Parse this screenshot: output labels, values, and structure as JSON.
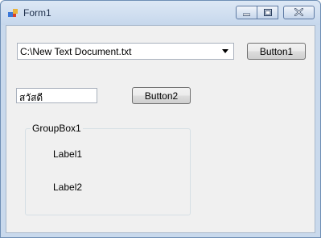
{
  "window": {
    "title": "Form1",
    "icon": "windows-form-icon",
    "caption_buttons": [
      "minimize-icon",
      "maximize-icon",
      "close-icon"
    ]
  },
  "combo": {
    "value": "C:\\New Text Document.txt",
    "arrow_icon": "chevron-down-icon"
  },
  "button1": {
    "label": "Button1"
  },
  "textbox": {
    "value": "สวัสดี"
  },
  "button2": {
    "label": "Button2"
  },
  "groupbox": {
    "title": "GroupBox1",
    "label1": "Label1",
    "label2": "Label2"
  },
  "colors": {
    "titlebar": "#c6d7ec",
    "client_bg": "#f0f0f0",
    "close_x": "#c0392b"
  }
}
